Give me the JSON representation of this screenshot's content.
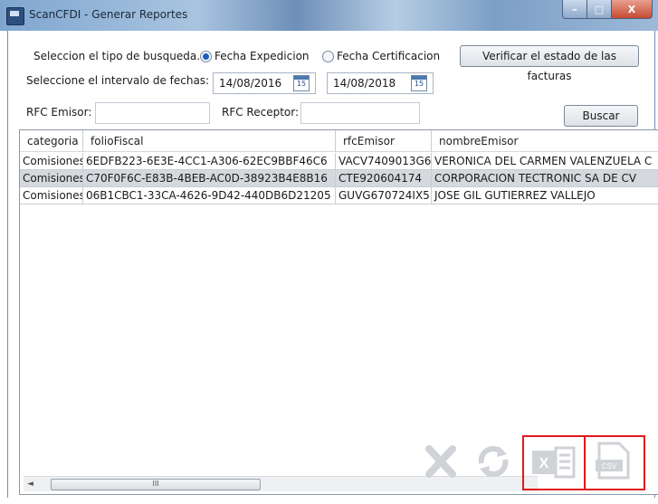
{
  "window": {
    "title": "ScanCFDI - Generar Reportes",
    "min": "–",
    "max": "□",
    "close": "X"
  },
  "search": {
    "type_label": "Seleccion el tipo de busqueda.",
    "opt_expedicion": "Fecha Expedicion",
    "opt_certificacion": "Fecha Certificacion",
    "selected": "Fecha Expedicion",
    "verify_button": "Verificar el estado de las facturas",
    "interval_label": "Seleccione el intervalo de fechas:",
    "date_from": "14/08/2016",
    "date_to": "14/08/2018",
    "cal_day": "15",
    "rfc_emisor_label": "RFC Emisor:",
    "rfc_emisor_value": "",
    "rfc_receptor_label": "RFC Receptor:",
    "rfc_receptor_value": "",
    "search_button": "Buscar"
  },
  "table": {
    "columns": [
      "categoria",
      "folioFiscal",
      "rfcEmisor",
      "nombreEmisor"
    ],
    "rows": [
      [
        "Comisiones",
        "6EDFB223-6E3E-4CC1-A306-62EC9BBF46C6",
        "VACV7409013G6",
        "VERONICA DEL CARMEN VALENZUELA C"
      ],
      [
        "Comisiones",
        "C70F0F6C-E83B-4BEB-AC0D-38923B4E8B16",
        "CTE920604174",
        "CORPORACION TECTRONIC SA DE CV"
      ],
      [
        "Comisiones",
        "06B1CBC1-33CA-4626-9D42-440DB6D21205",
        "GUVG670724IX5",
        "JOSE GIL GUTIERREZ VALLEJO"
      ]
    ],
    "selected_row": 1
  },
  "scrollbar": {
    "left_arrow": "◄",
    "thumb_grip": "III"
  },
  "actions": {
    "csv_label": "CSV"
  }
}
